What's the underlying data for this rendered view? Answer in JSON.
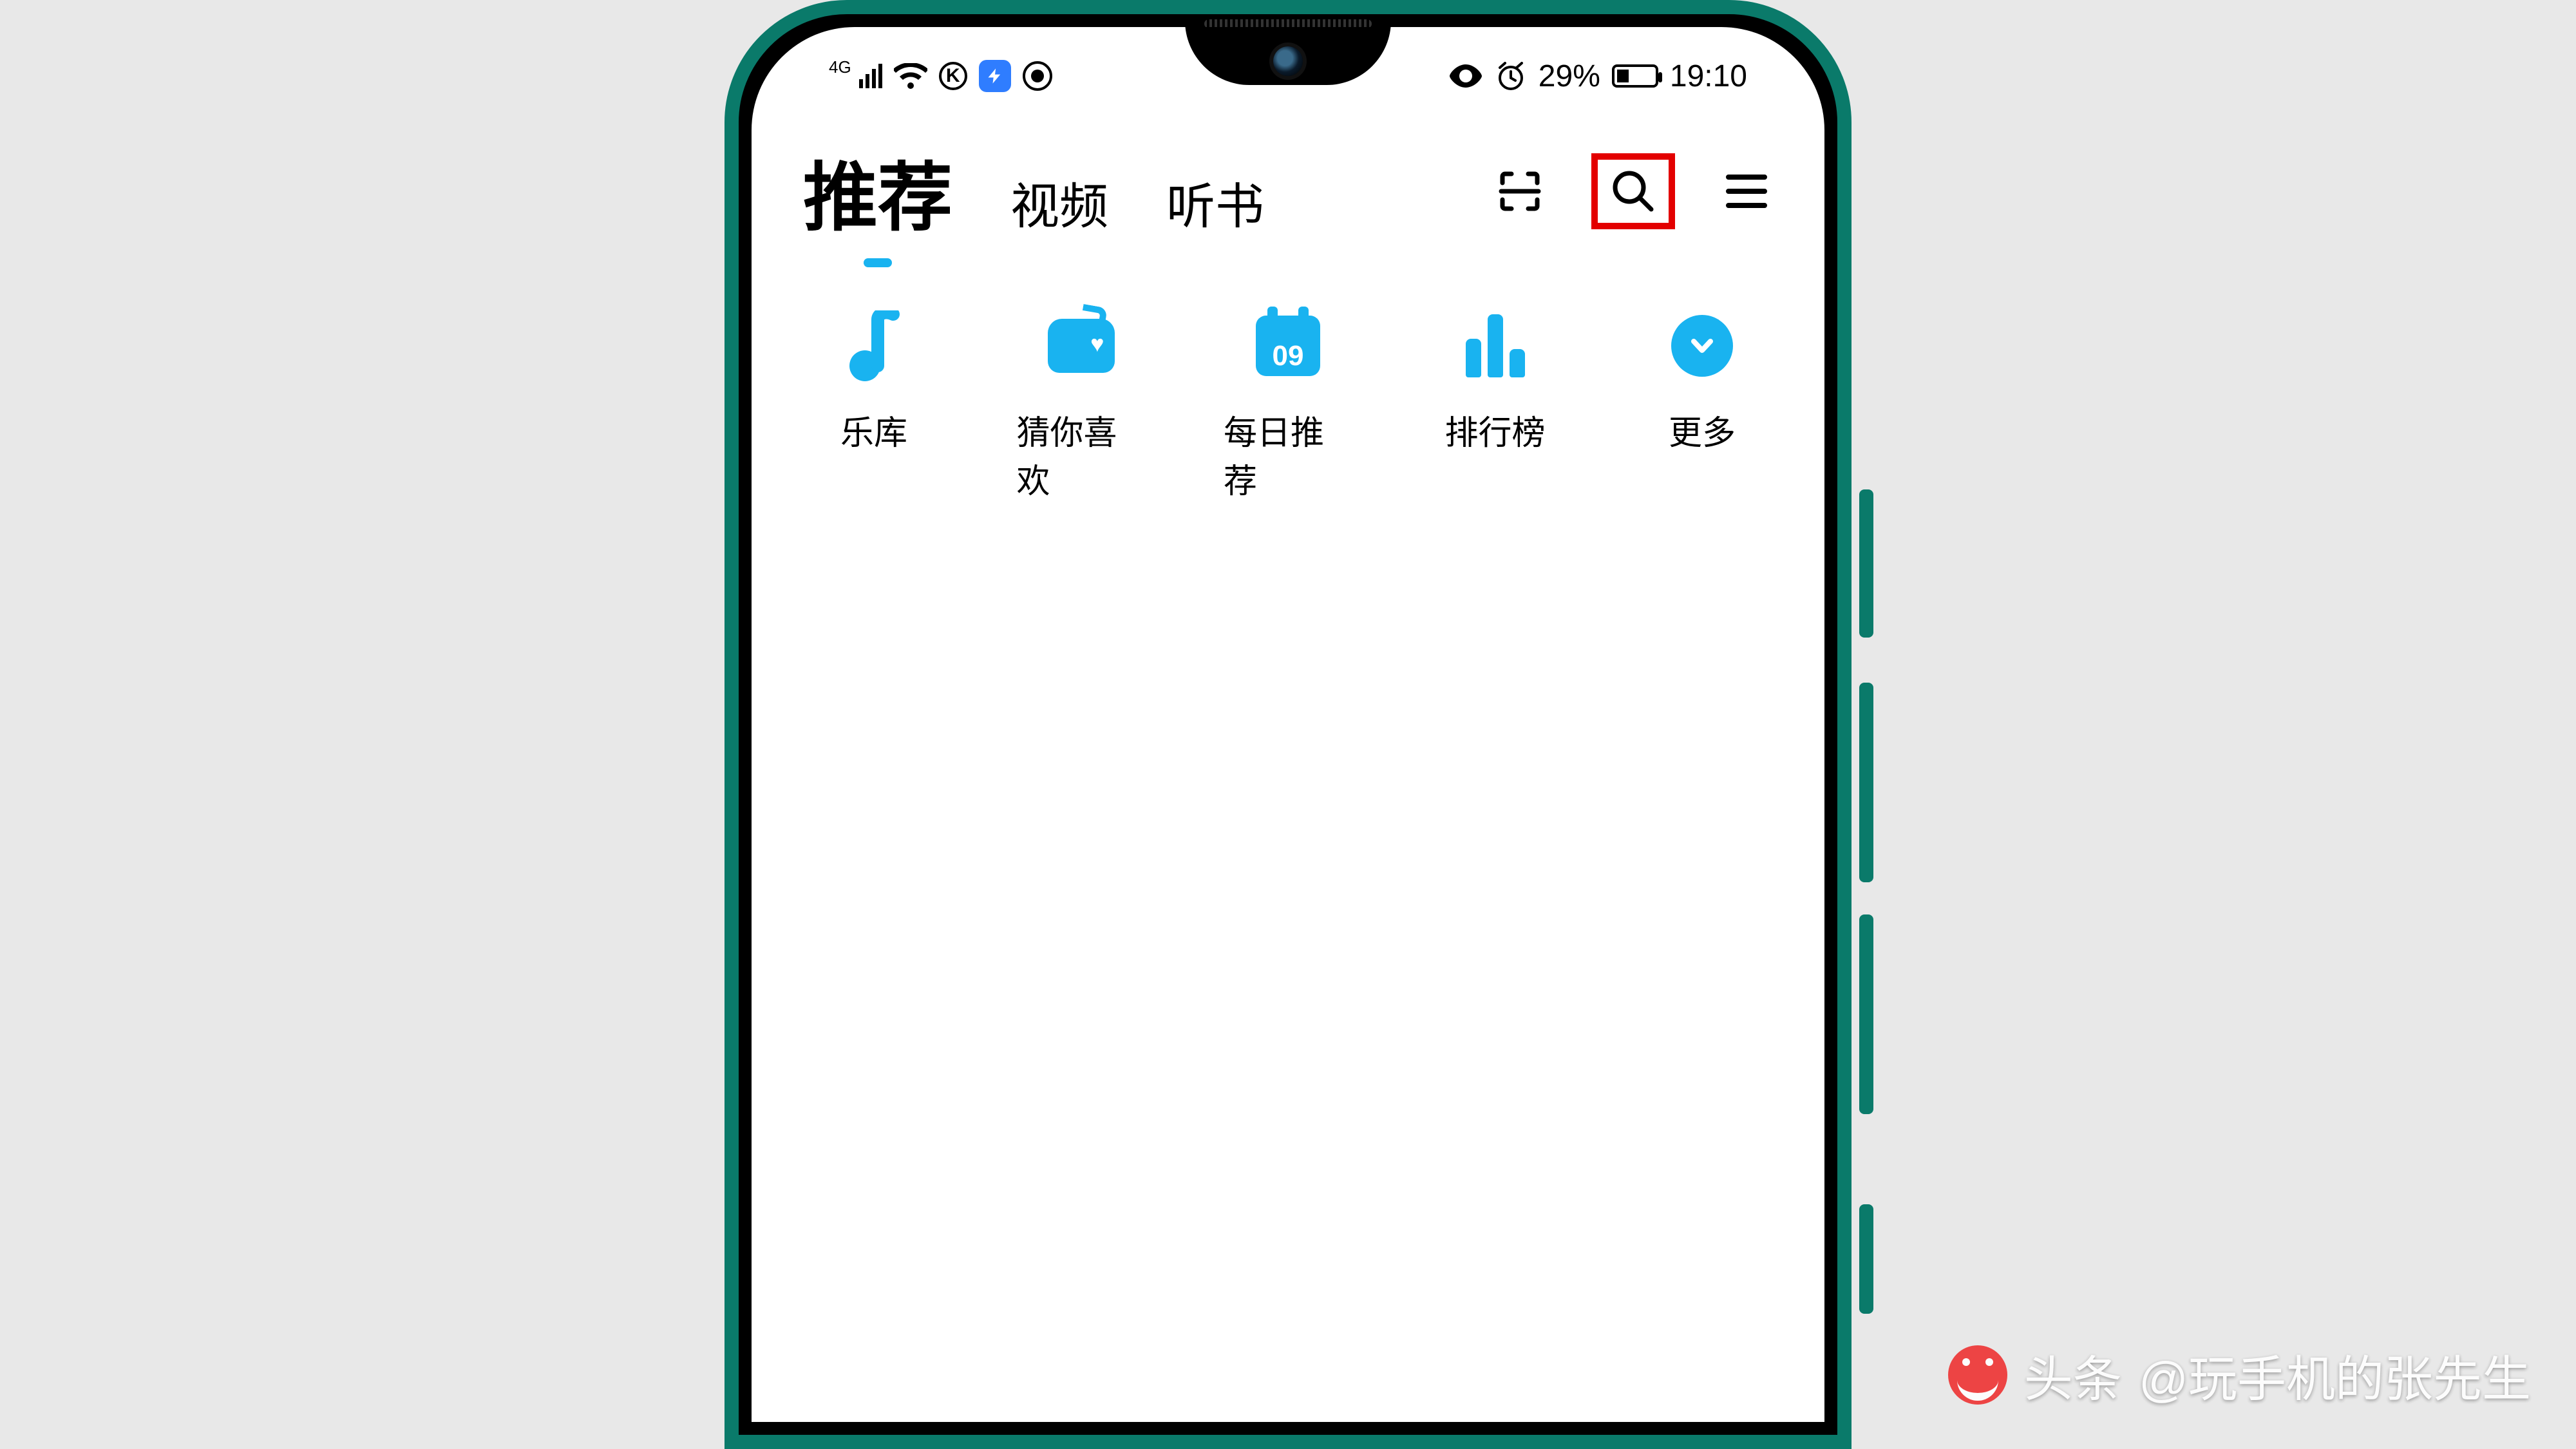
{
  "status": {
    "network_label": "4G",
    "battery_percent": "29%",
    "time": "19:10"
  },
  "header": {
    "tabs": [
      {
        "label": "推荐",
        "active": true
      },
      {
        "label": "视频",
        "active": false
      },
      {
        "label": "听书",
        "active": false
      }
    ],
    "scan_icon": "scan",
    "search_icon": "search",
    "menu_icon": "menu",
    "search_highlighted": true
  },
  "shortcuts": [
    {
      "id": "library",
      "label": "乐库"
    },
    {
      "id": "guess",
      "label": "猜你喜欢"
    },
    {
      "id": "daily",
      "label": "每日推荐",
      "badge": "09"
    },
    {
      "id": "ranking",
      "label": "排行榜"
    },
    {
      "id": "more",
      "label": "更多"
    }
  ],
  "colors": {
    "accent": "#19b3f0",
    "highlight_box": "#e30000",
    "frame": "#0a7a6a"
  },
  "watermark": {
    "brand": "头条",
    "handle": "@玩手机的张先生"
  }
}
